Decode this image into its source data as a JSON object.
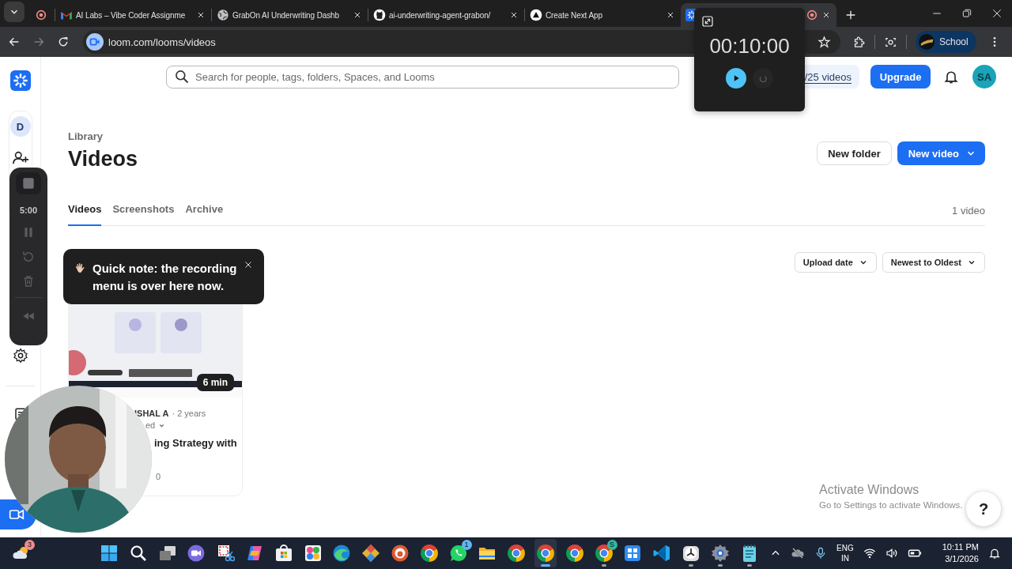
{
  "browser": {
    "tabs": [
      {
        "kind": "record",
        "selected": false,
        "recording": false
      },
      {
        "kind": "gmail",
        "title": "AI Labs – Vibe Coder Assignme",
        "selected": false,
        "recording": false
      },
      {
        "kind": "globe",
        "title": "GrabOn AI Underwriting Dashb",
        "selected": false,
        "recording": false
      },
      {
        "kind": "github",
        "title": "ai-underwriting-agent-grabon/",
        "selected": false,
        "recording": false
      },
      {
        "kind": "nextjs",
        "title": "Create Next App",
        "selected": false,
        "recording": false
      },
      {
        "kind": "loom",
        "selected": true,
        "recording": true
      }
    ],
    "address": "loom.com/looms/videos",
    "profile": "School"
  },
  "timer_popup": {
    "time": "00:10:00"
  },
  "search": {
    "placeholder": "Search for people, tags, folders, Spaces, and Looms"
  },
  "quota": "/25 videos",
  "upgrade": "Upgrade",
  "avatar": "SA",
  "sidebar": {
    "workspace": "D"
  },
  "recording_bar": {
    "time": "5:00"
  },
  "header": {
    "breadcrumb": "Library",
    "title": "Videos",
    "buttons": [
      {
        "label": "New folder",
        "kind": "secondary"
      },
      {
        "label": "New video",
        "kind": "primary"
      }
    ]
  },
  "library_tabs": [
    {
      "label": "Videos",
      "selected": true
    },
    {
      "label": "Screenshots",
      "selected": false
    },
    {
      "label": "Archive",
      "selected": false
    }
  ],
  "video_count": "1 video",
  "sort_menus": [
    "Upload date",
    "Newest to Oldest"
  ],
  "tooltip": {
    "text": "Quick note: the recording menu is over here now."
  },
  "video_card": {
    "duration": "6 min",
    "author": "ISHAL A",
    "age": "· 2 years",
    "status": "ed",
    "title": "ing Strategy with",
    "views": "0"
  },
  "activation_notice": {
    "title": "Activate Windows",
    "text": "Go to Settings to activate Windows."
  },
  "help": "?",
  "taskbar": {
    "apps": [
      {
        "kind": "weather",
        "badge": "3",
        "running": false,
        "selected": false
      },
      {
        "kind": "start",
        "running": false,
        "selected": false
      },
      {
        "kind": "search",
        "running": false,
        "selected": false
      },
      {
        "kind": "taskview",
        "running": false,
        "selected": false
      },
      {
        "kind": "meet",
        "running": false,
        "selected": false
      },
      {
        "kind": "snip",
        "running": false,
        "selected": false
      },
      {
        "kind": "copilot",
        "running": false,
        "selected": false
      },
      {
        "kind": "store",
        "running": false,
        "selected": false
      },
      {
        "kind": "tiles",
        "running": false,
        "selected": false
      },
      {
        "kind": "edge",
        "running": false,
        "selected": false
      },
      {
        "kind": "diamond",
        "running": false,
        "selected": false
      },
      {
        "kind": "duck",
        "running": false,
        "selected": false
      },
      {
        "kind": "chrome",
        "running": false,
        "selected": false
      },
      {
        "kind": "whatsapp",
        "badge": "1",
        "running": false,
        "selected": false
      },
      {
        "kind": "files",
        "running": false,
        "selected": false
      },
      {
        "kind": "chrome",
        "running": false,
        "selected": false
      },
      {
        "kind": "chrome",
        "running": true,
        "selected": true
      },
      {
        "kind": "chrome",
        "running": false,
        "selected": false
      },
      {
        "kind": "chrome",
        "badge": "S",
        "running": true,
        "selected": false
      },
      {
        "kind": "winapp",
        "running": false,
        "selected": false
      },
      {
        "kind": "vscode",
        "running": false,
        "selected": false
      },
      {
        "kind": "clock",
        "running": true,
        "selected": false
      },
      {
        "kind": "settings",
        "running": true,
        "selected": false
      },
      {
        "kind": "notepad",
        "running": true,
        "selected": false
      }
    ],
    "tray": {
      "language": "ENG",
      "region": "IN",
      "time": "10:11 PM",
      "date": "3/1/2026"
    }
  }
}
